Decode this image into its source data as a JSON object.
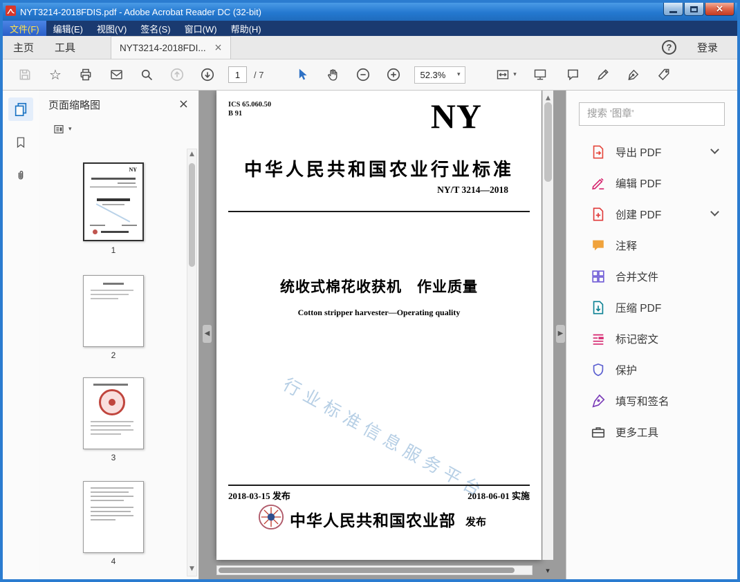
{
  "window": {
    "title": "NYT3214-2018FDIS.pdf - Adobe Acrobat Reader DC (32-bit)"
  },
  "glyphs": {
    "star": "☆",
    "close_x": "×",
    "help": "?",
    "caret_down": "▾",
    "arrow_up": "▲",
    "arrow_down": "▼",
    "collapse_left": "◀",
    "collapse_right": "▶"
  },
  "menubar": {
    "items": [
      {
        "label": "文件(F)",
        "active": true
      },
      {
        "label": "编辑(E)"
      },
      {
        "label": "视图(V)"
      },
      {
        "label": "签名(S)"
      },
      {
        "label": "窗口(W)"
      },
      {
        "label": "帮助(H)"
      }
    ]
  },
  "tabbar": {
    "home": "主页",
    "tools": "工具",
    "document_tab": "NYT3214-2018FDI...",
    "help": "?",
    "sign_in": "登录"
  },
  "toolbar": {
    "page_current": "1",
    "page_total": "/ 7",
    "zoom_level": "52.3%"
  },
  "left_panel": {
    "title": "页面缩略图",
    "pages": [
      "1",
      "2",
      "3",
      "4"
    ]
  },
  "document": {
    "ics": "ICS 65.060.50",
    "ics_class": "B 91",
    "logo": "NY",
    "standard_heading": "中华人民共和国农业行业标准",
    "standard_number": "NY/T 3214—2018",
    "title_cn": "统收式棉花收获机　作业质量",
    "title_en": "Cotton stripper harvester—Operating quality",
    "watermark": "行业标准信息服务平台",
    "issue_date": "2018-03-15 发布",
    "implement_date": "2018-06-01 实施",
    "publisher": "中华人民共和国农业部",
    "publish_label": "发布"
  },
  "right_panel": {
    "search_placeholder": "搜索 '图章'",
    "tools": [
      {
        "label": "导出 PDF",
        "expandable": true
      },
      {
        "label": "编辑 PDF"
      },
      {
        "label": "创建 PDF",
        "expandable": true
      },
      {
        "label": "注释"
      },
      {
        "label": "合并文件"
      },
      {
        "label": "压缩 PDF"
      },
      {
        "label": "标记密文"
      },
      {
        "label": "保护"
      },
      {
        "label": "填写和签名"
      },
      {
        "label": "更多工具"
      }
    ]
  }
}
